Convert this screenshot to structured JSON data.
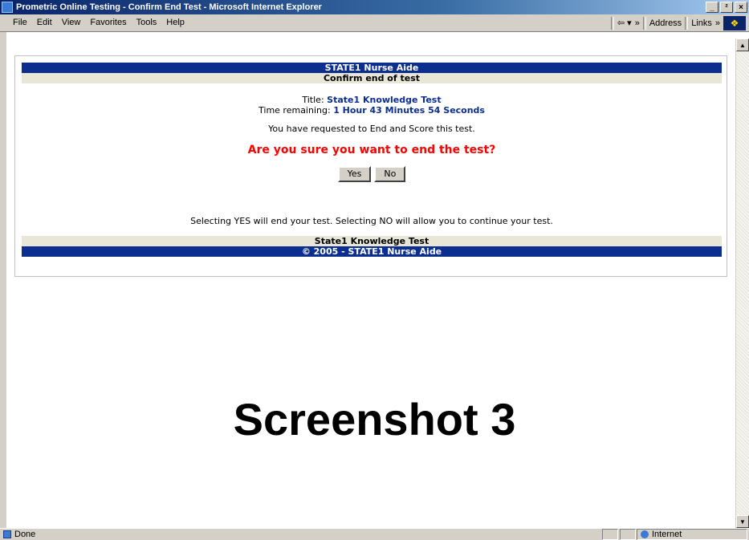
{
  "window": {
    "title": "Prometric Online Testing - Confirm End Test - Microsoft Internet Explorer",
    "controls": [
      "_",
      "²",
      "×"
    ]
  },
  "menubar": {
    "items": [
      "File",
      "Edit",
      "View",
      "Favorites",
      "Tools",
      "Help"
    ],
    "address_label": "Address",
    "links_label": "Links",
    "chevron": "»",
    "back_arrow": "⇦ ▾"
  },
  "page": {
    "header_title": "STATE1 Nurse Aide",
    "header_subtitle": "Confirm end of test",
    "title_label": "Title:",
    "title_value": "State1 Knowledge Test",
    "time_label": "Time remaining:",
    "time_value": "1 Hour 43 Minutes 54 Seconds",
    "request_text": "You have requested to End and Score this test.",
    "question": "Are you sure you want to end the test?",
    "yes_label": "Yes",
    "no_label": "No",
    "info_text": "Selecting YES will end your test. Selecting NO will allow you to continue your test.",
    "footer_title": "State1 Knowledge Test",
    "footer_copyright": "© 2005 - STATE1 Nurse Aide"
  },
  "caption": "Screenshot 3",
  "statusbar": {
    "left_text": "Done",
    "zone_text": "Internet"
  }
}
